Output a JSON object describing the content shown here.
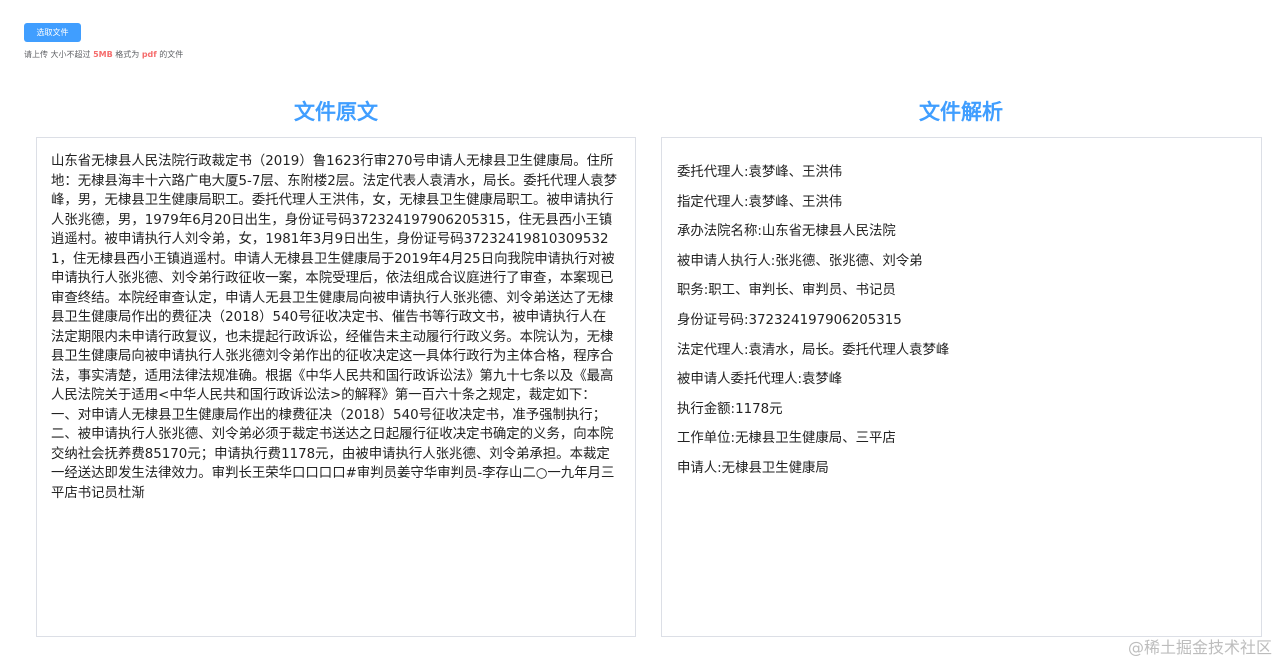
{
  "upload": {
    "button_label": "选取文件",
    "tip_prefix": "请上传 大小不超过 ",
    "tip_size": "5MB",
    "tip_middle": " 格式为 ",
    "tip_format": "pdf",
    "tip_suffix": " 的文件"
  },
  "left_panel": {
    "title": "文件原文",
    "content": "山东省无棣县人民法院行政裁定书（2019）鲁1623行审270号申请人无棣县卫生健康局。住所地：无棣县海丰十六路广电大厦5-7层、东附楼2层。法定代表人袁清水，局长。委托代理人袁梦峰，男，无棣县卫生健康局职工。委托代理人王洪伟，女，无棣县卫生健康局职工。被申请执行人张兆德，男，1979年6月20日出生，身份证号码372324197906205315，住无县西小王镇逍遥村。被申请执行人刘令弟，女，1981年3月9日出生，身份证号码372324198103095321，住无棣县西小王镇逍遥村。申请人无棣县卫生健康局于2019年4月25日向我院申请执行对被申请执行人张兆德、刘令弟行政征收一案，本院受理后，依法组成合议庭进行了审查，本案现已审查终结。本院经审查认定，申请人无县卫生健康局向被申请执行人张兆德、刘令弟送达了无棣县卫生健康局作出的费征决（2018）540号征收决定书、催告书等行政文书，被申请执行人在法定期限内未申请行政复议，也未提起行政诉讼，经催告未主动履行行政义务。本院认为，无棣县卫生健康局向被申请执行人张兆德刘令弟作出的征收决定这一具体行政行为主体合格，程序合法，事实清楚，适用法律法规准确。根据《中华人民共和国行政诉讼法》第九十七条以及《最高人民法院关于适用<中华人民共和国行政诉讼法>的解释》第一百六十条之规定，裁定如下：一、对申请人无棣县卫生健康局作出的棣费征决（2018）540号征收决定书，准予强制执行；二、被申请执行人张兆德、刘令弟必须于裁定书送达之日起履行征收决定书确定的义务，向本院交纳社会抚养费85170元；申请执行费1178元，由被申请执行人张兆德、刘令弟承担。本裁定一经送达即发生法律效力。审判长王荣华口口口口#审判员姜守华审判员-李存山二○一九年月三平店书记员杜渐"
  },
  "right_panel": {
    "title": "文件解析",
    "items": [
      "委托代理人:袁梦峰、王洪伟",
      "指定代理人:袁梦峰、王洪伟",
      "承办法院名称:山东省无棣县人民法院",
      "被申请人执行人:张兆德、张兆德、刘令弟",
      "职务:职工、审判长、审判员、书记员",
      "身份证号码:372324197906205315",
      "法定代理人:袁清水，局长。委托代理人袁梦峰",
      "被申请人委托代理人:袁梦峰",
      "执行金额:1178元",
      "工作单位:无棣县卫生健康局、三平店",
      "申请人:无棣县卫生健康局"
    ]
  },
  "watermark": "@稀土掘金技术社区",
  "colors": {
    "accent": "#409eff",
    "highlight": "#f56c6c",
    "border": "#dcdfe6"
  }
}
